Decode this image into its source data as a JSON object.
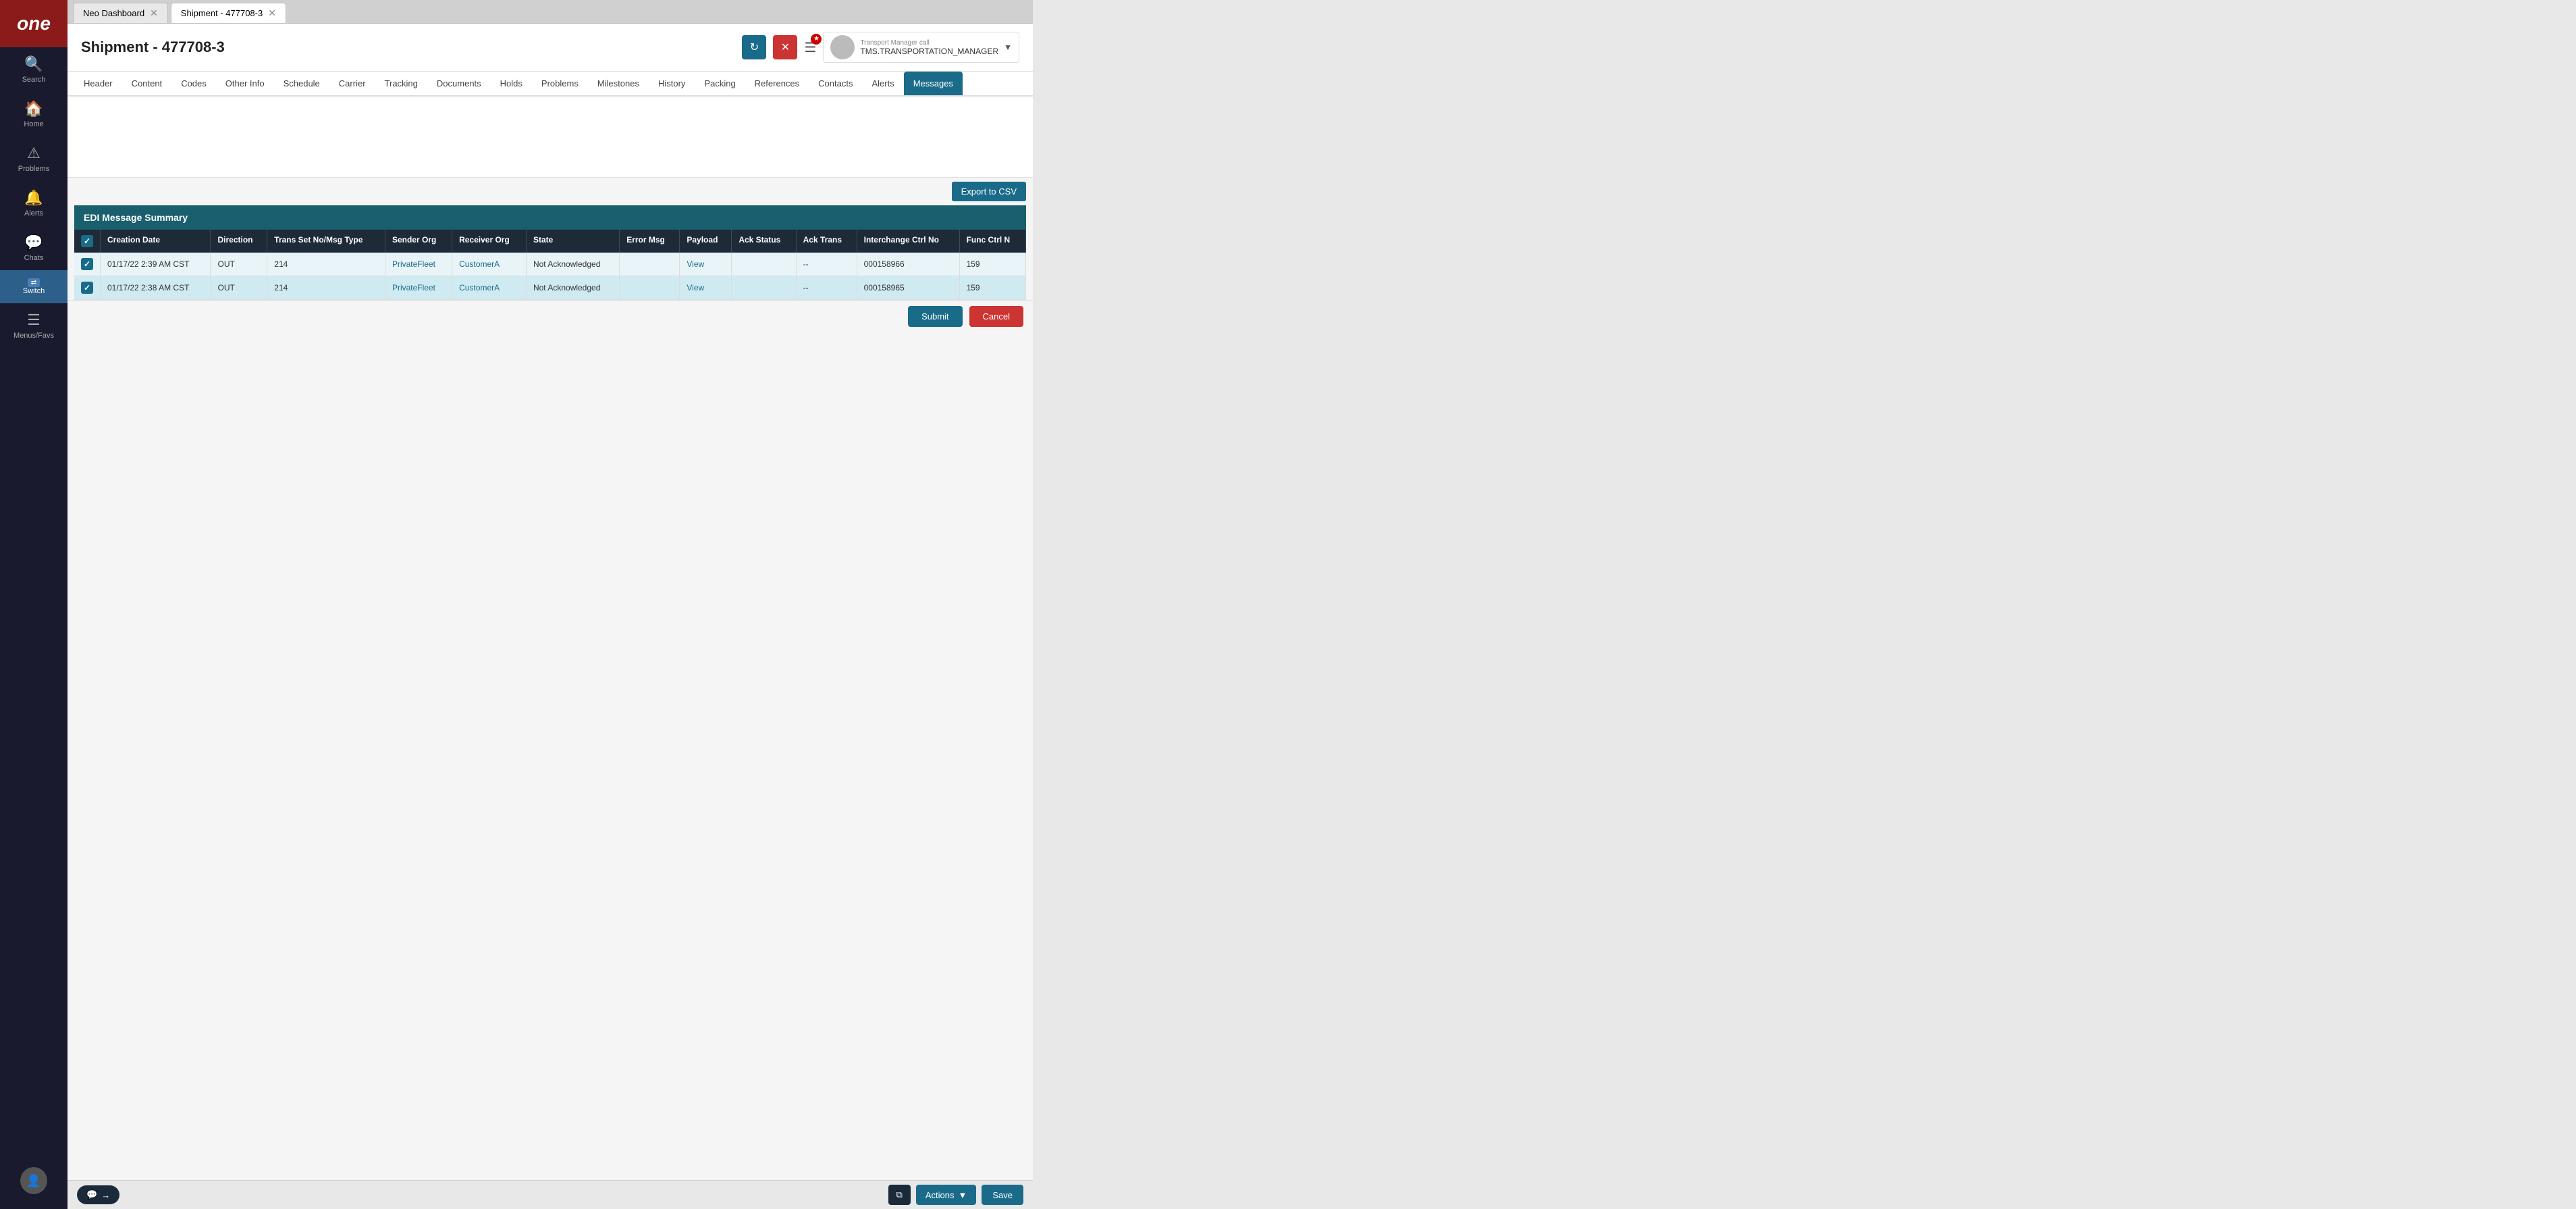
{
  "app": {
    "logo": "one",
    "logo_bg": "#8b1a1a"
  },
  "sidebar": {
    "items": [
      {
        "id": "search",
        "label": "Search",
        "icon": "🔍"
      },
      {
        "id": "home",
        "label": "Home",
        "icon": "🏠"
      },
      {
        "id": "problems",
        "label": "Problems",
        "icon": "⚠"
      },
      {
        "id": "alerts",
        "label": "Alerts",
        "icon": "🔔"
      },
      {
        "id": "chats",
        "label": "Chats",
        "icon": "💬"
      },
      {
        "id": "switch",
        "label": "Switch",
        "icon": "⇄"
      },
      {
        "id": "menus",
        "label": "Menus/Favs",
        "icon": "☰"
      }
    ]
  },
  "top_tabs": [
    {
      "id": "neo-dashboard",
      "label": "Neo Dashboard",
      "closeable": true
    },
    {
      "id": "shipment",
      "label": "Shipment - 477708-3",
      "closeable": true,
      "active": true
    }
  ],
  "header": {
    "title": "Shipment - 477708-3",
    "refresh_label": "↻",
    "close_label": "✕",
    "user_name": "TMS.TRANSPORTATION_MANAGER"
  },
  "content_tabs": [
    {
      "id": "header",
      "label": "Header"
    },
    {
      "id": "content",
      "label": "Content"
    },
    {
      "id": "codes",
      "label": "Codes"
    },
    {
      "id": "other-info",
      "label": "Other Info"
    },
    {
      "id": "schedule",
      "label": "Schedule"
    },
    {
      "id": "carrier",
      "label": "Carrier"
    },
    {
      "id": "tracking",
      "label": "Tracking"
    },
    {
      "id": "documents",
      "label": "Documents"
    },
    {
      "id": "holds",
      "label": "Holds"
    },
    {
      "id": "problems",
      "label": "Problems"
    },
    {
      "id": "milestones",
      "label": "Milestones"
    },
    {
      "id": "history",
      "label": "History"
    },
    {
      "id": "packing",
      "label": "Packing"
    },
    {
      "id": "references",
      "label": "References"
    },
    {
      "id": "contacts",
      "label": "Contacts"
    },
    {
      "id": "alerts",
      "label": "Alerts"
    },
    {
      "id": "messages",
      "label": "Messages",
      "active": true
    }
  ],
  "export_button": "Export to CSV",
  "edi_section": {
    "title": "EDI Message Summary",
    "columns": [
      {
        "id": "checkbox",
        "label": ""
      },
      {
        "id": "creation_date",
        "label": "Creation Date"
      },
      {
        "id": "direction",
        "label": "Direction"
      },
      {
        "id": "trans_set",
        "label": "Trans Set No/Msg Type"
      },
      {
        "id": "sender_org",
        "label": "Sender Org"
      },
      {
        "id": "receiver_org",
        "label": "Receiver Org"
      },
      {
        "id": "state",
        "label": "State"
      },
      {
        "id": "error_msg",
        "label": "Error Msg"
      },
      {
        "id": "payload",
        "label": "Payload"
      },
      {
        "id": "ack_status",
        "label": "Ack Status"
      },
      {
        "id": "ack_trans",
        "label": "Ack Trans"
      },
      {
        "id": "interchange_ctrl",
        "label": "Interchange Ctrl No"
      },
      {
        "id": "func_ctrl",
        "label": "Func Ctrl N"
      }
    ],
    "rows": [
      {
        "checked": true,
        "creation_date": "01/17/22 2:39 AM CST",
        "direction": "OUT",
        "trans_set": "214",
        "sender_org": "PrivateFleet",
        "receiver_org": "CustomerA",
        "state": "Not Acknowledged",
        "error_msg": "",
        "payload": "View",
        "ack_status": "",
        "ack_trans": "--",
        "interchange_ctrl": "000158966",
        "func_ctrl": "159"
      },
      {
        "checked": true,
        "creation_date": "01/17/22 2:38 AM CST",
        "direction": "OUT",
        "trans_set": "214",
        "sender_org": "PrivateFleet",
        "receiver_org": "CustomerA",
        "state": "Not Acknowledged",
        "error_msg": "",
        "payload": "View",
        "ack_status": "",
        "ack_trans": "--",
        "interchange_ctrl": "000158965",
        "func_ctrl": "159"
      }
    ]
  },
  "dialog_buttons": {
    "submit": "Submit",
    "cancel": "Cancel"
  },
  "footer": {
    "actions_label": "Actions",
    "save_label": "Save"
  }
}
